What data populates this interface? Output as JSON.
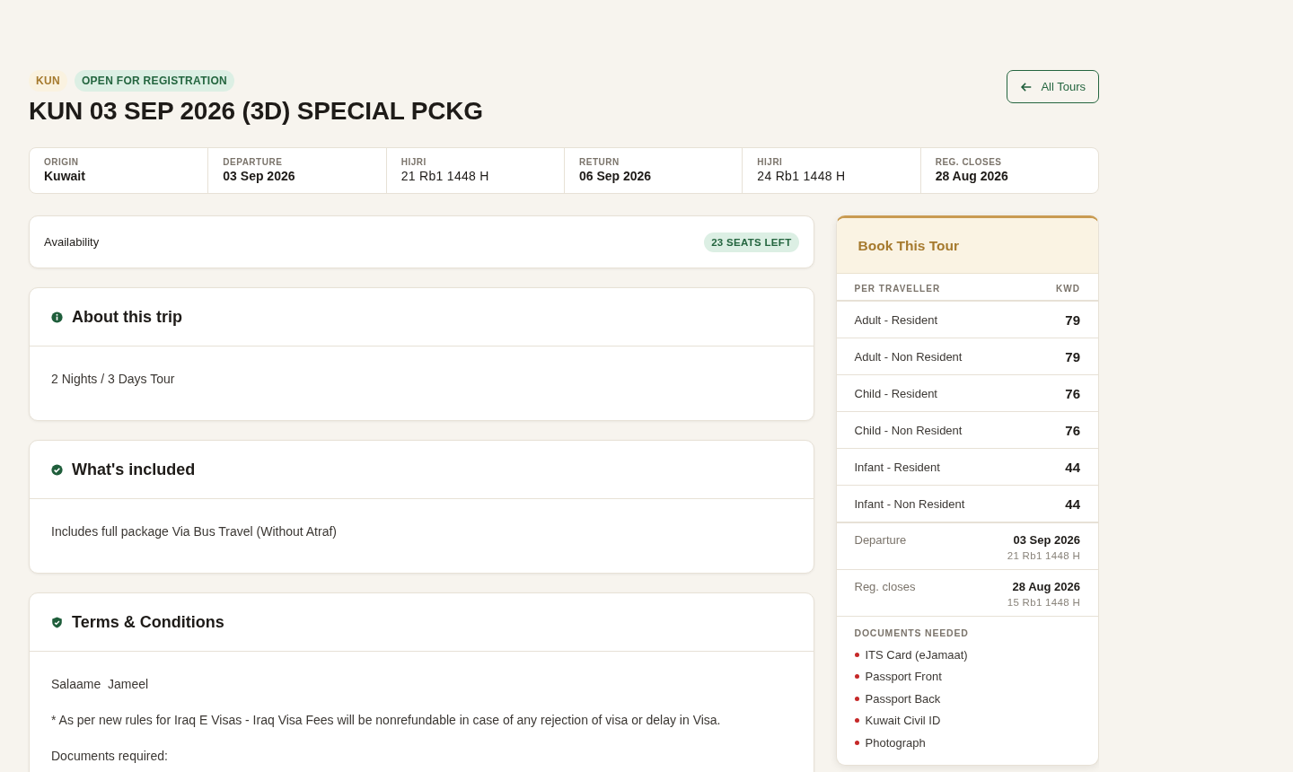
{
  "header": {
    "code_badge": "KUN",
    "status_badge": "OPEN FOR REGISTRATION",
    "title": "KUN 03 SEP 2026 (3D) SPECIAL PCKG",
    "back_button": "All Tours"
  },
  "facts": [
    {
      "label": "ORIGIN",
      "value": "Kuwait",
      "kind": "bold"
    },
    {
      "label": "DEPARTURE",
      "value": "03 Sep 2026",
      "kind": "bold"
    },
    {
      "label": "HIJRI",
      "value": "21 Rb1 1448 H",
      "kind": "plain"
    },
    {
      "label": "RETURN",
      "value": "06 Sep 2026",
      "kind": "bold"
    },
    {
      "label": "HIJRI",
      "value": "24 Rb1 1448 H",
      "kind": "plain"
    },
    {
      "label": "REG. CLOSES",
      "value": "28 Aug 2026",
      "kind": "bold"
    }
  ],
  "availability": {
    "label": "Availability",
    "seats": "23 SEATS LEFT"
  },
  "sections": [
    {
      "kind": "about",
      "title": "About this trip",
      "paragraphs": [
        "2 Nights / 3 Days Tour"
      ]
    },
    {
      "kind": "inclusions",
      "title": "What's included",
      "paragraphs": [
        "Includes full package Via Bus Travel (Without Atraf)"
      ]
    },
    {
      "kind": "terms",
      "title": "Terms & Conditions",
      "paragraphs": [
        "Salaame  Jameel",
        "* As per new rules for Iraq E Visas - Iraq Visa Fees will be nonrefundable in case of any rejection of visa or delay in Visa.",
        "Documents required:"
      ]
    }
  ],
  "booking": {
    "title": "Book This Tour",
    "price_header": "PER TRAVELLER",
    "currency": "KWD",
    "prices": [
      {
        "label": "Adult - Resident",
        "amount": "79"
      },
      {
        "label": "Adult - Non Resident",
        "amount": "79"
      },
      {
        "label": "Child - Resident",
        "amount": "76"
      },
      {
        "label": "Child - Non Resident",
        "amount": "76"
      },
      {
        "label": "Infant - Resident",
        "amount": "44"
      },
      {
        "label": "Infant - Non Resident",
        "amount": "44"
      }
    ],
    "dates": [
      {
        "label": "Departure",
        "date": "03 Sep 2026",
        "hijri": "21 Rb1 1448 H"
      },
      {
        "label": "Reg. closes",
        "date": "28 Aug 2026",
        "hijri": "15 Rb1 1448 H"
      }
    ],
    "documents_title": "DOCUMENTS NEEDED",
    "documents": [
      "ITS Card (eJamaat)",
      "Passport Front",
      "Passport Back",
      "Kuwait Civil ID",
      "Photograph"
    ]
  }
}
